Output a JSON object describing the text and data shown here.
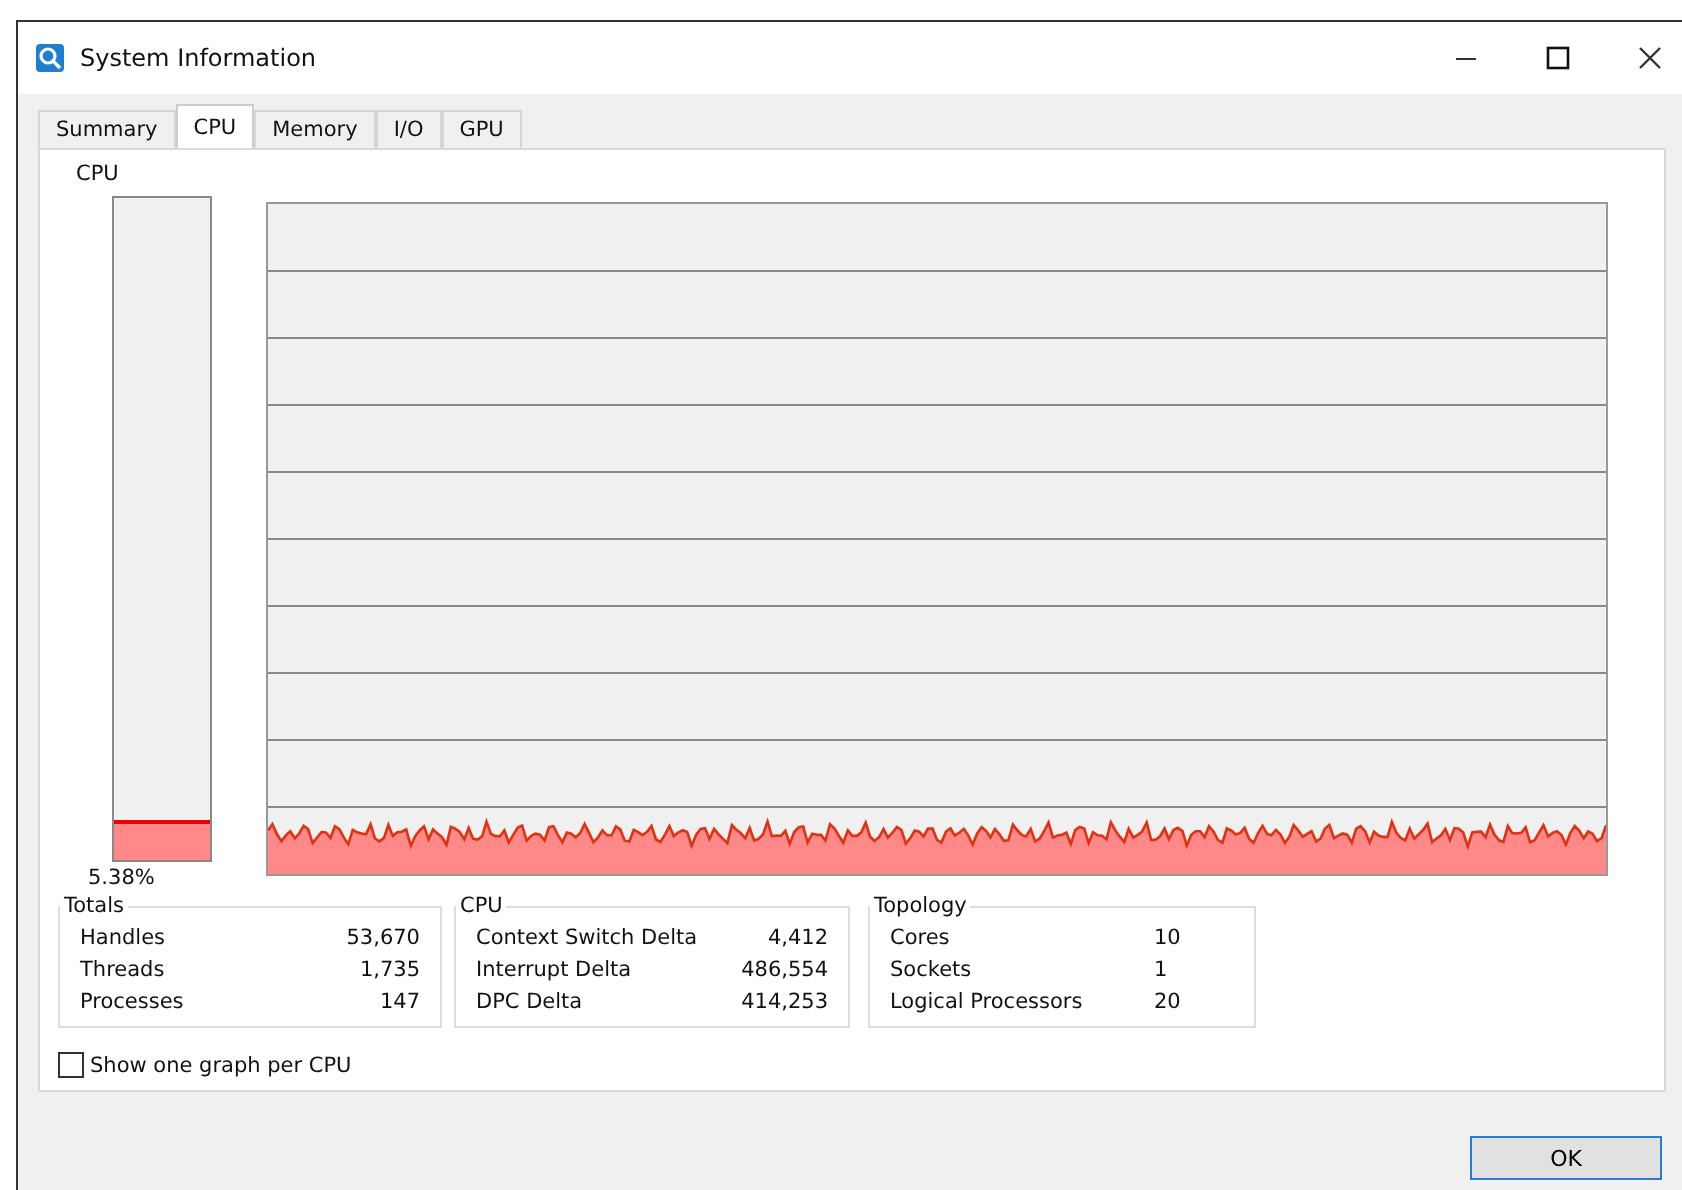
{
  "window": {
    "title": "System Information"
  },
  "tabs": [
    {
      "label": "Summary",
      "selected": false
    },
    {
      "label": "CPU",
      "selected": true
    },
    {
      "label": "Memory",
      "selected": false
    },
    {
      "label": "I/O",
      "selected": false
    },
    {
      "label": "GPU",
      "selected": false
    }
  ],
  "meter": {
    "label": "CPU",
    "level": 0.0538,
    "reading": "5.38%"
  },
  "groups": [
    {
      "title": "Totals",
      "rows": [
        {
          "label": "Handles",
          "value": "53,670"
        },
        {
          "label": "Threads",
          "value": "1,735"
        },
        {
          "label": "Processes",
          "value": "147"
        }
      ]
    },
    {
      "title": "CPU",
      "rows": [
        {
          "label": "Context Switch Delta",
          "value": "4,412"
        },
        {
          "label": "Interrupt Delta",
          "value": "486,554"
        },
        {
          "label": "DPC Delta",
          "value": "414,253"
        }
      ]
    },
    {
      "title": "Topology",
      "rows": [
        {
          "label": "Cores",
          "value": "10"
        },
        {
          "label": "Sockets",
          "value": "1"
        },
        {
          "label": "Logical Processors",
          "value": "20"
        }
      ]
    }
  ],
  "one_graph_per_cpu": {
    "label": "Show one graph per CPU",
    "checked": false
  },
  "buttons": [
    "OK"
  ]
}
